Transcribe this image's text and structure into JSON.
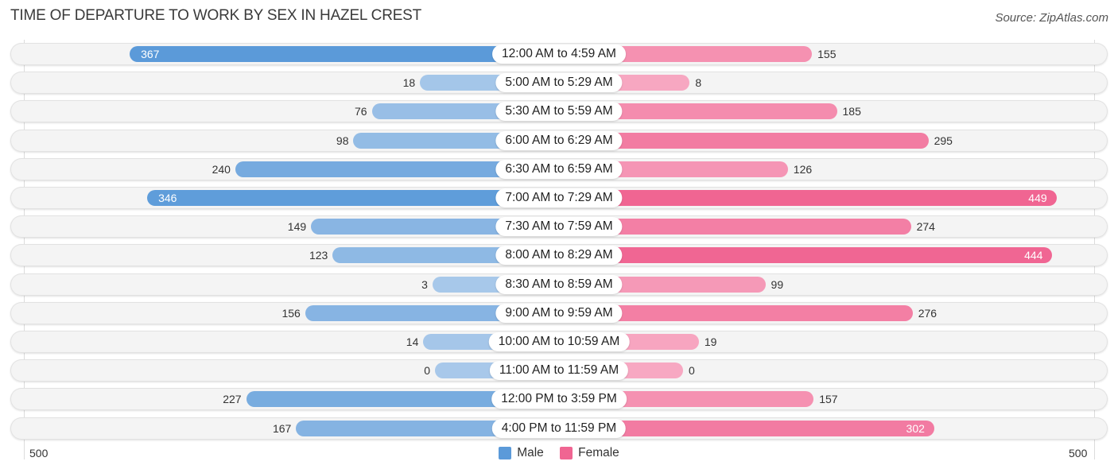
{
  "header": {
    "title": "TIME OF DEPARTURE TO WORK BY SEX IN HAZEL CREST",
    "source": "Source: ZipAtlas.com"
  },
  "colors": {
    "male_strong": "#5b9ad9",
    "male_light": "#a8c8ea",
    "female_strong": "#f06592",
    "female_light": "#f7a8c2",
    "row_bg": "#f4f4f4"
  },
  "legend": {
    "male": "Male",
    "female": "Female"
  },
  "axis": {
    "left_tick": "500",
    "right_tick": "500"
  },
  "chart_data": {
    "type": "bar",
    "orientation": "horizontal-diverging",
    "title": "TIME OF DEPARTURE TO WORK BY SEX IN HAZEL CREST",
    "categories": [
      "12:00 AM to 4:59 AM",
      "5:00 AM to 5:29 AM",
      "5:30 AM to 5:59 AM",
      "6:00 AM to 6:29 AM",
      "6:30 AM to 6:59 AM",
      "7:00 AM to 7:29 AM",
      "7:30 AM to 7:59 AM",
      "8:00 AM to 8:29 AM",
      "8:30 AM to 8:59 AM",
      "9:00 AM to 9:59 AM",
      "10:00 AM to 10:59 AM",
      "11:00 AM to 11:59 AM",
      "12:00 PM to 3:59 PM",
      "4:00 PM to 11:59 PM"
    ],
    "series": [
      {
        "name": "Male",
        "values": [
          367,
          18,
          76,
          98,
          240,
          346,
          149,
          123,
          3,
          156,
          14,
          0,
          227,
          167
        ]
      },
      {
        "name": "Female",
        "values": [
          155,
          8,
          185,
          295,
          126,
          449,
          274,
          444,
          99,
          276,
          19,
          0,
          157,
          302
        ]
      }
    ],
    "xlim": [
      -500,
      500
    ],
    "xticks": [
      "500",
      "500"
    ],
    "legend_position": "bottom-center",
    "grid": false
  }
}
